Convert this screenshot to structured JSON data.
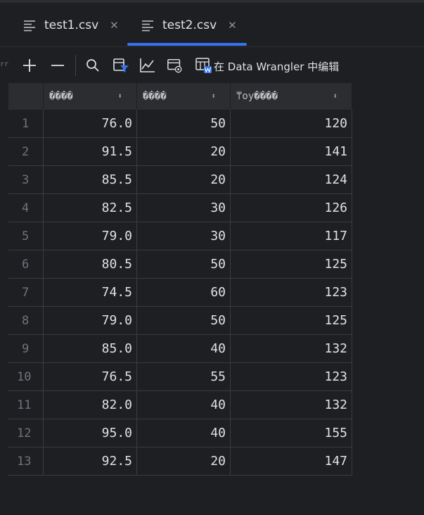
{
  "tabs": [
    {
      "label": "test1.csv",
      "active": false
    },
    {
      "label": "test2.csv",
      "active": true
    }
  ],
  "toolbar": {
    "data_wrangler_label": "在 Data Wrangler 中编辑",
    "left_edge_glyph": "rr"
  },
  "colors": {
    "accent": "#3574f0",
    "background": "#1e1f22",
    "header_bg": "#2b2d30"
  },
  "table": {
    "headers": [
      "����",
      "����",
      "⍑oy����"
    ],
    "rows": [
      [
        "1",
        "76.0",
        "50",
        "120"
      ],
      [
        "2",
        "91.5",
        "20",
        "141"
      ],
      [
        "3",
        "85.5",
        "20",
        "124"
      ],
      [
        "4",
        "82.5",
        "30",
        "126"
      ],
      [
        "5",
        "79.0",
        "30",
        "117"
      ],
      [
        "6",
        "80.5",
        "50",
        "125"
      ],
      [
        "7",
        "74.5",
        "60",
        "123"
      ],
      [
        "8",
        "79.0",
        "50",
        "125"
      ],
      [
        "9",
        "85.0",
        "40",
        "132"
      ],
      [
        "10",
        "76.5",
        "55",
        "123"
      ],
      [
        "11",
        "82.0",
        "40",
        "132"
      ],
      [
        "12",
        "95.0",
        "40",
        "155"
      ],
      [
        "13",
        "92.5",
        "20",
        "147"
      ]
    ]
  }
}
